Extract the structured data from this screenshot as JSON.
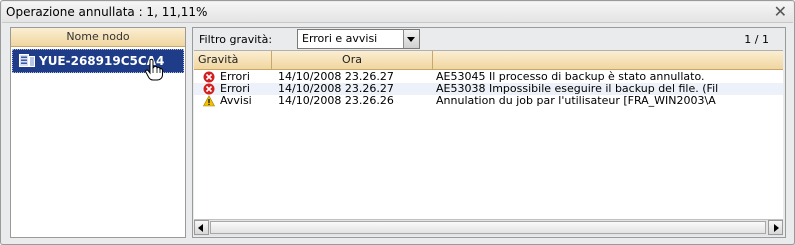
{
  "window": {
    "title": "Operazione annullata : 1, 11,11%",
    "close_icon": "close-icon"
  },
  "nodes_panel": {
    "header": "Nome nodo",
    "items": [
      {
        "label": "YUE-268919C5CA4",
        "icon": "server-icon",
        "selected": true
      }
    ]
  },
  "filter": {
    "label": "Filtro gravità:",
    "selected": "Errori e avvisi"
  },
  "pagination": {
    "text": "1 / 1"
  },
  "log_table": {
    "columns": [
      "Gravità",
      "Ora",
      ""
    ],
    "rows": [
      {
        "icon": "error-icon",
        "severity": "Errori",
        "time": "14/10/2008 23.26.27",
        "message": "AE53045 Il processo di backup è stato annullato."
      },
      {
        "icon": "error-icon",
        "severity": "Errori",
        "time": "14/10/2008 23.26.27",
        "message": "AE53038 Impossibile eseguire il backup del file. (Fil"
      },
      {
        "icon": "warning-icon",
        "severity": "Avvisi",
        "time": "14/10/2008 23.26.26",
        "message": "Annulation du job par l'utilisateur [FRA_WIN2003\\A"
      }
    ]
  },
  "colors": {
    "selection": "#1e3c88",
    "header_bg": "#f0d6a0",
    "error": "#d02020",
    "warning": "#f2c200"
  }
}
